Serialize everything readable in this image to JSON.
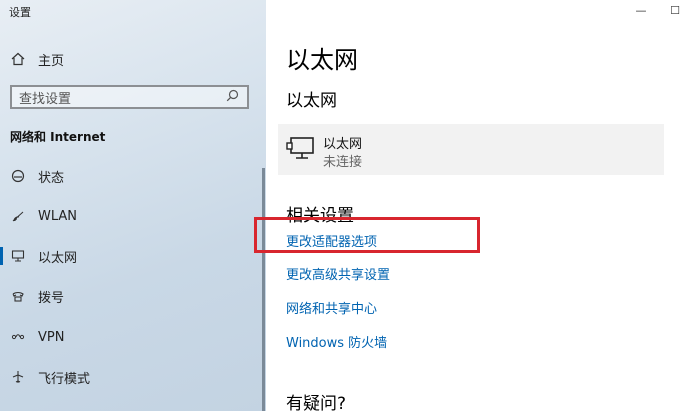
{
  "window": {
    "title": "设置",
    "min_glyph": "—",
    "max_glyph": "☐"
  },
  "sidebar": {
    "home_label": "主页",
    "search_placeholder": "查找设置",
    "section_title": "网络和 Internet",
    "items": [
      {
        "label": "状态",
        "icon": "status-icon"
      },
      {
        "label": "WLAN",
        "icon": "wifi-icon"
      },
      {
        "label": "以太网",
        "icon": "ethernet-icon",
        "active": true
      },
      {
        "label": "拨号",
        "icon": "dialup-icon"
      },
      {
        "label": "VPN",
        "icon": "vpn-icon"
      },
      {
        "label": "飞行模式",
        "icon": "airplane-icon"
      }
    ]
  },
  "main": {
    "title": "以太网",
    "subtitle": "以太网",
    "network": {
      "name": "以太网",
      "status": "未连接"
    },
    "related_title": "相关设置",
    "links": [
      "更改适配器选项",
      "更改高级共享设置",
      "网络和共享中心",
      "Windows 防火墙"
    ],
    "question": "有疑问?"
  },
  "colors": {
    "accent": "#0063b1",
    "highlight_box": "#d8262e",
    "card_bg": "#f2f2f2"
  }
}
